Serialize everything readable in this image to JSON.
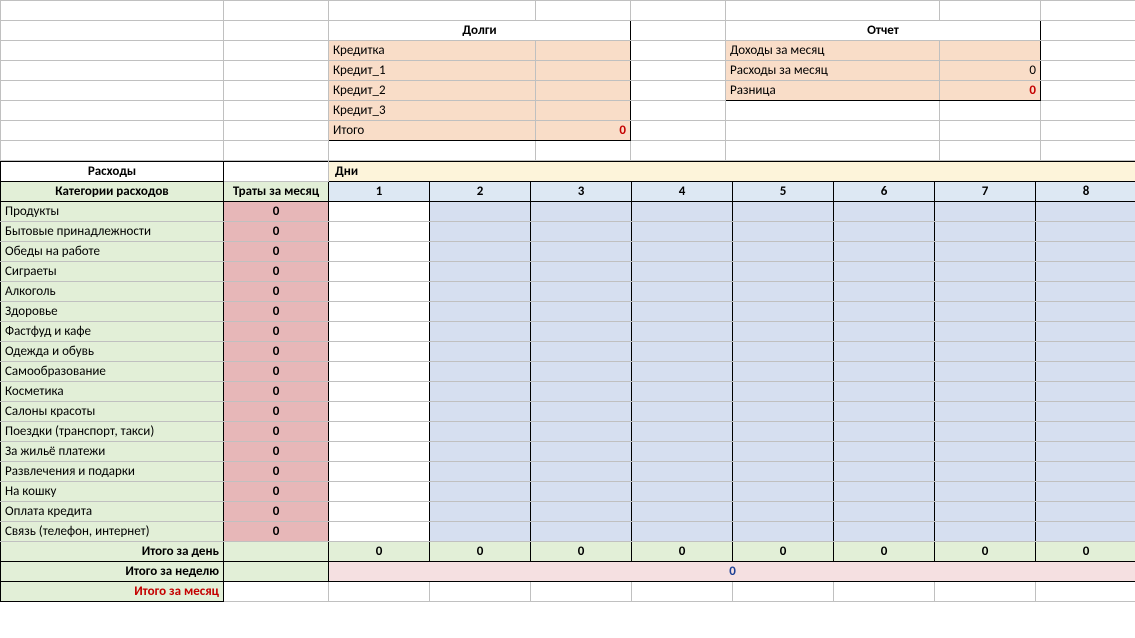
{
  "debts": {
    "title": "Долги",
    "rows": [
      {
        "label": "Кредитка",
        "value": ""
      },
      {
        "label": "Кредит_1",
        "value": ""
      },
      {
        "label": "Кредит_2",
        "value": ""
      },
      {
        "label": "Кредит_3",
        "value": ""
      }
    ],
    "total_label": "Итого",
    "total_value": "0"
  },
  "report": {
    "title": "Отчет",
    "rows": [
      {
        "label": "Доходы за месяц",
        "value": ""
      },
      {
        "label": "Расходы за месяц",
        "value": "0"
      },
      {
        "label": "Разница",
        "value": "0",
        "em": true
      }
    ]
  },
  "expenses": {
    "title": "Расходы",
    "cat_header": "Категории расходов",
    "month_header": "Траты за месяц",
    "days_title": "Дни",
    "days": [
      "1",
      "2",
      "3",
      "4",
      "5",
      "6",
      "7",
      "8"
    ],
    "categories": [
      "Продукты",
      "Бытовые принадлежности",
      "Обеды на работе",
      "Сиграеты",
      "Алкоголь",
      "Здоровье",
      "Фастфуд и кафе",
      "Одежда и обувь",
      "Самообразование",
      "Косметика",
      "Салоны красоты",
      "Поездки (транспорт, такси)",
      "За жильё платежи",
      "Развлечения и подарки",
      "На кошку",
      "Оплата кредита",
      "Связь (телефон, интернет)"
    ],
    "month_totals": [
      "0",
      "0",
      "0",
      "0",
      "0",
      "0",
      "0",
      "0",
      "0",
      "0",
      "0",
      "0",
      "0",
      "0",
      "0",
      "0",
      "0"
    ],
    "day_total_label": "Итого за день",
    "day_totals": [
      "0",
      "0",
      "0",
      "0",
      "0",
      "0",
      "0",
      "0"
    ],
    "week_total_label": "Итого за неделю",
    "week_total": "0",
    "month_total_label": "Итого за месяц"
  }
}
